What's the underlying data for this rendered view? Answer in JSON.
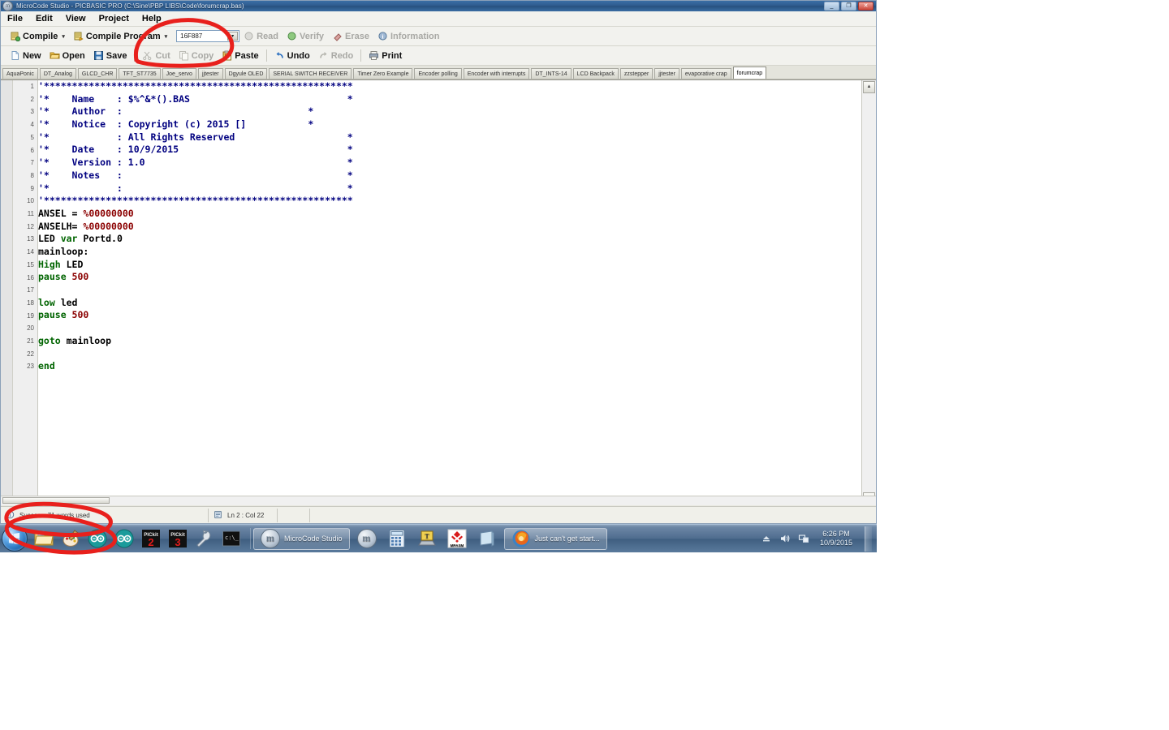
{
  "window": {
    "title": "MicroCode Studio - PICBASIC PRO (C:\\Sine\\PBP LIBS\\Code\\forumcrap.bas)",
    "icon": "app-mcs-icon",
    "minimize": "_",
    "restore": "❐",
    "close": "✕"
  },
  "menu": {
    "items": [
      {
        "label": "File"
      },
      {
        "label": "Edit"
      },
      {
        "label": "View"
      },
      {
        "label": "Project"
      },
      {
        "label": "Help"
      }
    ]
  },
  "toolbar_compile": {
    "compile": "Compile",
    "compile_program": "Compile Program",
    "device": "16F887",
    "read": "Read",
    "verify": "Verify",
    "erase": "Erase",
    "information": "Information",
    "caret": "▾",
    "combo_arrow": "▾"
  },
  "toolbar_file": {
    "new": "New",
    "open": "Open",
    "save": "Save",
    "cut": "Cut",
    "copy": "Copy",
    "paste": "Paste",
    "undo": "Undo",
    "redo": "Redo",
    "print": "Print"
  },
  "tabs": [
    {
      "label": "AquaPonic",
      "active": false
    },
    {
      "label": "DT_Analog",
      "active": false
    },
    {
      "label": "GLCD_CHR",
      "active": false
    },
    {
      "label": "TFT_ST7735",
      "active": false
    },
    {
      "label": "Joe_servo",
      "active": false
    },
    {
      "label": "jjtester",
      "active": false
    },
    {
      "label": "Dgyule OLED",
      "active": false
    },
    {
      "label": "SERIAL SWITCH RECEIVER",
      "active": false
    },
    {
      "label": "Timer Zero Example",
      "active": false
    },
    {
      "label": "Encoder polling",
      "active": false
    },
    {
      "label": "Encoder with interrupts",
      "active": false
    },
    {
      "label": "DT_INTS-14",
      "active": false
    },
    {
      "label": "LCD Backpack",
      "active": false
    },
    {
      "label": "zzstepper",
      "active": false
    },
    {
      "label": "jjtester",
      "active": false
    },
    {
      "label": "evaporative crap",
      "active": false
    },
    {
      "label": "forumcrap",
      "active": true
    }
  ],
  "code": {
    "lines": [
      {
        "n": "1",
        "tokens": [
          {
            "t": "'*******************************************************",
            "c": "c-comment"
          }
        ]
      },
      {
        "n": "2",
        "tokens": [
          {
            "t": "'*    Name    : $%^&*().BAS                            *",
            "c": "c-comment"
          }
        ]
      },
      {
        "n": "3",
        "tokens": [
          {
            "t": "'*    Author  :                                 *",
            "c": "c-comment"
          }
        ]
      },
      {
        "n": "4",
        "tokens": [
          {
            "t": "'*    Notice  : Copyright (c) 2015 []           *",
            "c": "c-comment"
          }
        ]
      },
      {
        "n": "5",
        "tokens": [
          {
            "t": "'*            : All Rights Reserved                    *",
            "c": "c-comment"
          }
        ]
      },
      {
        "n": "6",
        "tokens": [
          {
            "t": "'*    Date    : 10/9/2015                              *",
            "c": "c-comment"
          }
        ]
      },
      {
        "n": "7",
        "tokens": [
          {
            "t": "'*    Version : 1.0                                    *",
            "c": "c-comment"
          }
        ]
      },
      {
        "n": "8",
        "tokens": [
          {
            "t": "'*    Notes   :                                        *",
            "c": "c-comment"
          }
        ]
      },
      {
        "n": "9",
        "tokens": [
          {
            "t": "'*            :                                        *",
            "c": "c-comment"
          }
        ]
      },
      {
        "n": "10",
        "tokens": [
          {
            "t": "'*******************************************************",
            "c": "c-comment"
          }
        ]
      },
      {
        "n": "11",
        "tokens": [
          {
            "t": "ANSEL = ",
            "c": "c-plain"
          },
          {
            "t": "%00000000",
            "c": "c-num"
          }
        ]
      },
      {
        "n": "12",
        "tokens": [
          {
            "t": "ANSELH= ",
            "c": "c-plain"
          },
          {
            "t": "%00000000",
            "c": "c-num"
          }
        ]
      },
      {
        "n": "13",
        "tokens": [
          {
            "t": "LED ",
            "c": "c-plain"
          },
          {
            "t": "var",
            "c": "c-kw"
          },
          {
            "t": " Portd.0",
            "c": "c-plain"
          }
        ]
      },
      {
        "n": "14",
        "tokens": [
          {
            "t": "mainloop:",
            "c": "c-plain"
          }
        ]
      },
      {
        "n": "15",
        "tokens": [
          {
            "t": "High",
            "c": "c-kw"
          },
          {
            "t": " LED",
            "c": "c-plain"
          }
        ]
      },
      {
        "n": "16",
        "tokens": [
          {
            "t": "pause ",
            "c": "c-kw"
          },
          {
            "t": "500",
            "c": "c-num"
          }
        ]
      },
      {
        "n": "17",
        "tokens": [
          {
            "t": "",
            "c": "c-plain"
          }
        ]
      },
      {
        "n": "18",
        "tokens": [
          {
            "t": "low",
            "c": "c-kw"
          },
          {
            "t": " led",
            "c": "c-plain"
          }
        ]
      },
      {
        "n": "19",
        "tokens": [
          {
            "t": "pause ",
            "c": "c-kw"
          },
          {
            "t": "500",
            "c": "c-num"
          }
        ]
      },
      {
        "n": "20",
        "tokens": [
          {
            "t": "",
            "c": "c-plain"
          }
        ]
      },
      {
        "n": "21",
        "tokens": [
          {
            "t": "goto",
            "c": "c-kw"
          },
          {
            "t": " mainloop",
            "c": "c-plain"
          }
        ]
      },
      {
        "n": "22",
        "tokens": [
          {
            "t": "",
            "c": "c-plain"
          }
        ]
      },
      {
        "n": "23",
        "tokens": [
          {
            "t": "end",
            "c": "c-kw"
          }
        ]
      }
    ]
  },
  "statusbar": {
    "compile_result": "Success: 71 words used",
    "caret_position": "Ln 2 : Col 22",
    "extra": ""
  },
  "taskbar": {
    "start_label": "Start",
    "quicklaunch": [
      {
        "name": "explorer-icon",
        "label": "Windows Explorer"
      },
      {
        "name": "paint-icon",
        "label": "Paint"
      },
      {
        "name": "arduino-icon",
        "label": "Arduino"
      },
      {
        "name": "arduino-icon-2",
        "label": "Arduino"
      },
      {
        "name": "pickit2-icon",
        "label": "PICkit 2"
      },
      {
        "name": "pickit3-icon",
        "label": "PICkit 3"
      },
      {
        "name": "wrench-icon",
        "label": "Tool"
      },
      {
        "name": "console-icon",
        "label": "Command Prompt"
      }
    ],
    "windows": [
      {
        "name": "microcode-studio-task",
        "label": "MicroCode Studio",
        "active": true
      },
      {
        "name": "microcode-studio-task-2",
        "label": "",
        "active": false
      },
      {
        "name": "calculator-task",
        "label": "",
        "active": false
      },
      {
        "name": "laptop-task",
        "label": "",
        "active": false
      },
      {
        "name": "mplab-task",
        "label": "",
        "active": false
      },
      {
        "name": "notepad-task",
        "label": "",
        "active": false
      },
      {
        "name": "firefox-task",
        "label": "Just can't get start...",
        "active": false
      }
    ],
    "tray": {
      "eject": "⏏",
      "volume": "volume-icon",
      "network": "network-icon",
      "time": "6:26 PM",
      "date": "10/9/2015"
    }
  },
  "annotation": {
    "color": "#e8201c",
    "marks": [
      {
        "name": "circle-toolbar-paste-area"
      },
      {
        "name": "circle-status-success-area"
      },
      {
        "name": "circle-taskbar-area"
      }
    ]
  }
}
